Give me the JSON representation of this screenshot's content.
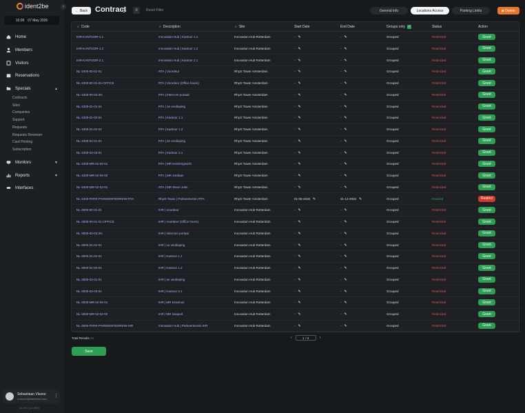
{
  "logo": {
    "text": "ident2be"
  },
  "sidebar": {
    "time": "10:09",
    "date": "07 May 2026",
    "nav": [
      {
        "label": "Home",
        "icon": "home-icon"
      },
      {
        "label": "Members",
        "icon": "user-icon"
      },
      {
        "label": "Visitors",
        "icon": "badge-icon"
      },
      {
        "label": "Reservations",
        "icon": "calendar-icon"
      },
      {
        "label": "Specials",
        "icon": "folder-icon"
      }
    ],
    "specials_sub": [
      "Contracts",
      "Sites",
      "Companies",
      "Support",
      "Requests",
      "Requests Reviewer",
      "Card Printing",
      "Subscription"
    ],
    "nav_bottom": [
      {
        "label": "Monitors",
        "icon": "monitor-icon"
      },
      {
        "label": "Reports",
        "icon": "chart-icon"
      },
      {
        "label": "Interfaces",
        "icon": "plug-icon"
      }
    ],
    "user": {
      "name": "Sebastiaan Vlezee",
      "email": "s.vlezee@ident2be.com"
    },
    "version": "v2.29.x (v2-909)"
  },
  "header": {
    "back_label": "Back",
    "title": "Contract",
    "reset_filter": "Reset Filter",
    "tabs": [
      {
        "label": "General info",
        "active": false
      },
      {
        "label": "Locations Access",
        "active": true
      },
      {
        "label": "Parking Limits",
        "active": false
      }
    ],
    "delete_label": "Delete"
  },
  "table": {
    "headers": {
      "code": "Code",
      "description": "Description",
      "site": "Site",
      "start": "Start Date",
      "end": "End Date",
      "grouped": "Groups only",
      "status": "Status",
      "action": "Action"
    },
    "rows": [
      {
        "code": "IHR-KANTOOR-1.1",
        "desc": "Innovation Hub | Kantoor 1.1",
        "site": "Innovation Hub Rotterdam",
        "start": "-",
        "end": "-",
        "grouped": "Grouped",
        "status": "Restricted",
        "action": "Grant"
      },
      {
        "code": "IHR-KANTOOR-1.2",
        "desc": "Innovation Hub | Kantoor 1.2",
        "site": "Innovation Hub Rotterdam",
        "start": "-",
        "end": "-",
        "grouped": "Grouped",
        "status": "Restricted",
        "action": "Grant"
      },
      {
        "code": "IHR-KANTOOR-2.1",
        "desc": "Innovation Hub | Kantoor 2.1",
        "site": "Innovation Hub Rotterdam",
        "start": "-",
        "end": "-",
        "grouped": "Grouped",
        "status": "Restricted",
        "action": "Grant"
      },
      {
        "code": "NL-1000-00-01-01",
        "desc": "RTA | Voordeur",
        "site": "Rhyzt Tower Amsterdam",
        "start": "-",
        "end": "-",
        "grouped": "Grouped",
        "status": "Restricted",
        "action": "Grant"
      },
      {
        "code": "NL-1000-00-01-01-OFFICE",
        "desc": "RTA | Voordeur (Office hours)",
        "site": "Rhyzt Tower Amsterdam",
        "start": "-",
        "end": "-",
        "grouped": "Grouped",
        "status": "Restricted",
        "action": "Grant"
      },
      {
        "code": "NL-1000-00-03-2N",
        "desc": "RTA | Intercom portaal",
        "site": "Rhyzt Tower Amsterdam",
        "start": "-",
        "end": "-",
        "grouped": "Grouped",
        "status": "Restricted",
        "action": "Grant"
      },
      {
        "code": "NL-1000-01-01-01",
        "desc": "RTA | 1e verdieping",
        "site": "Rhyzt Tower Amsterdam",
        "start": "-",
        "end": "-",
        "grouped": "Grouped",
        "status": "Restricted",
        "action": "Grant"
      },
      {
        "code": "NL-1000-01-02-01",
        "desc": "RTA | Kantoor 1.1",
        "site": "Rhyzt Tower Amsterdam",
        "start": "-",
        "end": "-",
        "grouped": "Grouped",
        "status": "Restricted",
        "action": "Grant"
      },
      {
        "code": "NL-1000-01-02-02",
        "desc": "RTA | Kantoor 1.2",
        "site": "Rhyzt Tower Amsterdam",
        "start": "-",
        "end": "-",
        "grouped": "Grouped",
        "status": "Restricted",
        "action": "Grant"
      },
      {
        "code": "NL-1000-02-01-01",
        "desc": "RTA | 2e verdieping",
        "site": "Rhyzt Tower Amsterdam",
        "start": "-",
        "end": "-",
        "grouped": "Grouped",
        "status": "Restricted",
        "action": "Grant"
      },
      {
        "code": "NL-1000-02-03-01",
        "desc": "RTA | Kantoor 2.1",
        "site": "Rhyzt Tower Amsterdam",
        "start": "-",
        "end": "-",
        "grouped": "Grouped",
        "status": "Restricted",
        "action": "Grant"
      },
      {
        "code": "NL-1000-MR-02-02-01",
        "desc": "RTA | MR Keizersgracht",
        "site": "Rhyzt Tower Amsterdam",
        "start": "-",
        "end": "-",
        "grouped": "Grouped",
        "status": "Restricted",
        "action": "Grant"
      },
      {
        "code": "NL-1000-MR-02-02-02",
        "desc": "RTA | MR Jordaan",
        "site": "Rhyzt Tower Amsterdam",
        "start": "-",
        "end": "-",
        "grouped": "Grouped",
        "status": "Restricted",
        "action": "Grant"
      },
      {
        "code": "NL-1000-MR-02-03-01",
        "desc": "RTA | MR Steve Jobs",
        "site": "Rhyzt Tower Amsterdam",
        "start": "-",
        "end": "-",
        "grouped": "Grouped",
        "status": "Restricted",
        "action": "Grant"
      },
      {
        "code": "NL-1000-PARK-PARKEERTERREIN-RTA",
        "desc": "Rhyzt Tower | Parkeerterrein RTA",
        "site": "Rhyzt Tower Amsterdam",
        "start": "01-06-2026",
        "end": "31-12-2026",
        "grouped": "Grouped",
        "status": "Granted",
        "action": "Restrict"
      },
      {
        "code": "NL-3000-00-01-01",
        "desc": "IHR | Voordeur",
        "site": "Innovation Hub Rotterdam",
        "start": "-",
        "end": "-",
        "grouped": "Grouped",
        "status": "Restricted",
        "action": "Grant"
      },
      {
        "code": "NL-3000-00-01-01-OFFICE",
        "desc": "IHR | Voordeur (Office hours)",
        "site": "Innovation Hub Rotterdam",
        "start": "-",
        "end": "-",
        "grouped": "Grouped",
        "status": "Restricted",
        "action": "Grant"
      },
      {
        "code": "NL-3000-00-03-2N",
        "desc": "IHR | Intercom portaal",
        "site": "Innovation Hub Rotterdam",
        "start": "-",
        "end": "-",
        "grouped": "Grouped",
        "status": "Restricted",
        "action": "Grant"
      },
      {
        "code": "NL-3000-01-01-01",
        "desc": "IHR | 1e verdieping",
        "site": "Innovation Hub Rotterdam",
        "start": "-",
        "end": "-",
        "grouped": "Grouped",
        "status": "Restricted",
        "action": "Grant"
      },
      {
        "code": "NL-3000-01-02-01",
        "desc": "IHR | Kantoor 1.1",
        "site": "Innovation Hub Rotterdam",
        "start": "-",
        "end": "-",
        "grouped": "Grouped",
        "status": "Restricted",
        "action": "Grant"
      },
      {
        "code": "NL-3000-01-02-02",
        "desc": "IHR | Kantoor 1.2",
        "site": "Innovation Hub Rotterdam",
        "start": "-",
        "end": "-",
        "grouped": "Grouped",
        "status": "Restricted",
        "action": "Grant"
      },
      {
        "code": "NL-3000-02-01-01",
        "desc": "IHR | 2e verdieping",
        "site": "Innovation Hub Rotterdam",
        "start": "-",
        "end": "-",
        "grouped": "Grouped",
        "status": "Restricted",
        "action": "Grant"
      },
      {
        "code": "NL-3000-02-03-01",
        "desc": "IHR | Kantoor 2.1",
        "site": "Innovation Hub Rotterdam",
        "start": "-",
        "end": "-",
        "grouped": "Grouped",
        "status": "Restricted",
        "action": "Grant"
      },
      {
        "code": "NL-3000-MR-02-02-01",
        "desc": "IHR | MR Erasmus",
        "site": "Innovation Hub Rotterdam",
        "start": "-",
        "end": "-",
        "grouped": "Grouped",
        "status": "Restricted",
        "action": "Grant"
      },
      {
        "code": "NL-3000-MR-02-02-02",
        "desc": "IHR | MR Seaport",
        "site": "Innovation Hub Rotterdam",
        "start": "-",
        "end": "-",
        "grouped": "Grouped",
        "status": "Restricted",
        "action": "Grant"
      },
      {
        "code": "NL-3000-PARK-PARKEERTERREIN-IHR",
        "desc": "Innovation Hub | Parkeerterrein IHR",
        "site": "Innovation Hub Rotterdam",
        "start": "-",
        "end": "-",
        "grouped": "Grouped",
        "status": "Restricted",
        "action": "Grant"
      }
    ]
  },
  "footer": {
    "total_label": "Total Results",
    "total_value": "26",
    "page_current": "1",
    "page_total": "/ 3",
    "save_label": "Save"
  },
  "colors": {
    "grant": "#2e9e52",
    "restrict": "#d0392b",
    "restricted_text": "#e05a50",
    "granted_text": "#3aa35a",
    "accent_delete": "#e8762a"
  }
}
